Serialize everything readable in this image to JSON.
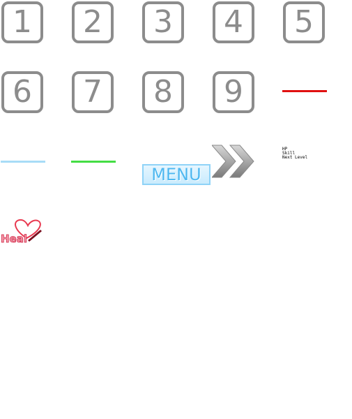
{
  "tiles": [
    {
      "label": "1"
    },
    {
      "label": "2"
    },
    {
      "label": "3"
    },
    {
      "label": "4"
    },
    {
      "label": "5"
    },
    {
      "label": "6"
    },
    {
      "label": "7"
    },
    {
      "label": "8"
    },
    {
      "label": "9"
    }
  ],
  "bars": {
    "red": {
      "color": "#e01010"
    },
    "light_blue": {
      "color": "#a8dcf7"
    },
    "green": {
      "color": "#44dd44"
    }
  },
  "menu": {
    "label": "MENU"
  },
  "stats": {
    "hp_label": "HP",
    "skill_label": "Skill",
    "next_level_label": "Next Level"
  },
  "heal": {
    "label": "Heal"
  },
  "icons": {
    "next": "double-chevron-right-icon",
    "heal": "heart-heal-icon"
  }
}
